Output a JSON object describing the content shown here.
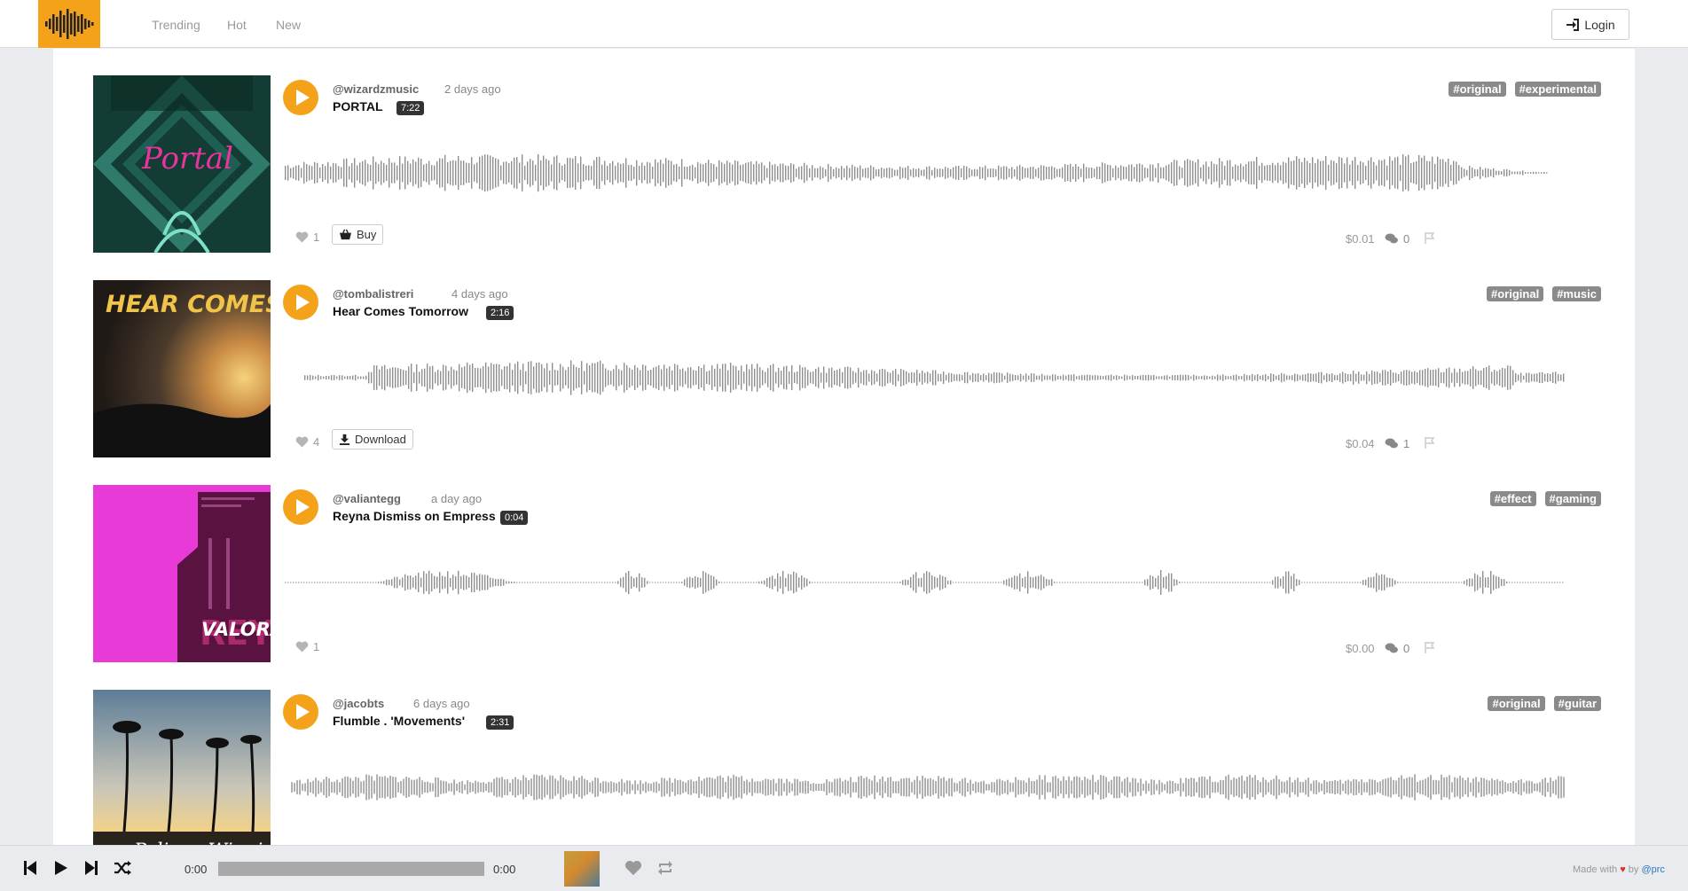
{
  "nav": {
    "links": [
      "Trending",
      "Hot",
      "New"
    ],
    "login_label": "Login"
  },
  "tracks": [
    {
      "user": "@wizardzmusic",
      "ago": "2 days ago",
      "title": "PORTAL",
      "duration": "7:22",
      "tags": [
        "#original",
        "#experimental"
      ],
      "likes": "1",
      "action": "Buy",
      "action_icon": "basket-icon",
      "price": "$0.01",
      "comments": "0",
      "cover_text": "Portal"
    },
    {
      "user": "@tombalistreri",
      "ago": "4 days ago",
      "title": "Hear Comes Tomorrow",
      "duration": "2:16",
      "tags": [
        "#original",
        "#music"
      ],
      "likes": "4",
      "action": "Download",
      "action_icon": "download-icon",
      "price": "$0.04",
      "comments": "1",
      "cover_text": "HEAR COMES TO"
    },
    {
      "user": "@valiantegg",
      "ago": "a day ago",
      "title": "Reyna Dismiss on Empress",
      "duration": "0:04",
      "tags": [
        "#effect",
        "#gaming"
      ],
      "likes": "1",
      "price": "$0.00",
      "comments": "0",
      "cover_text": "VALORA"
    },
    {
      "user": "@jacobts",
      "ago": "6 days ago",
      "title": "Flumble . 'Movements'",
      "duration": "2:31",
      "tags": [
        "#original",
        "#guitar"
      ],
      "cover_text": "Pelican Winni"
    }
  ],
  "player": {
    "current_time": "0:00",
    "total_time": "0:00",
    "progress": 0,
    "made_with": "Made with",
    "by": "by",
    "author": "@prc"
  },
  "colors": {
    "accent": "#f3a21a",
    "tag_bg": "#8a8a8a",
    "wave": "#8f8f8f"
  }
}
